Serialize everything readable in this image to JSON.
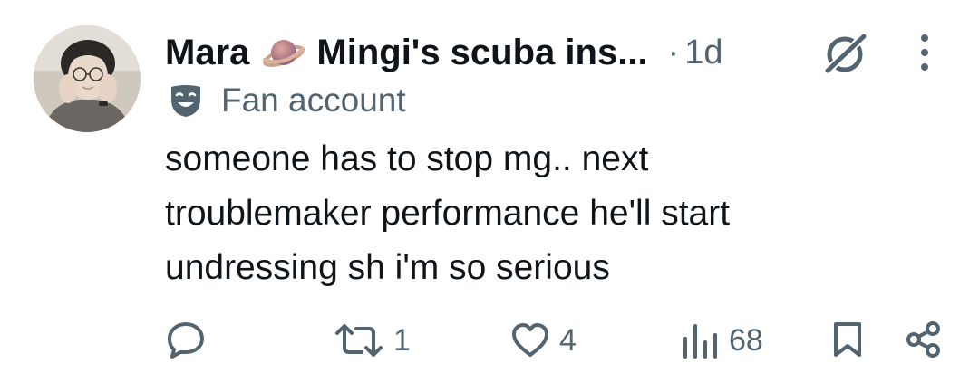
{
  "tweet": {
    "display_name": "Mara",
    "display_name_suffix": "Mingi's scuba ins...",
    "separator": "·",
    "timestamp": "1d",
    "badge_label": "Fan account",
    "text_lines": [
      "someone has to stop mg.. next",
      "troublemaker performance he'll start",
      "undressing sh i'm so serious"
    ]
  },
  "actions": {
    "reply_count": "",
    "repost_count": "1",
    "like_count": "4",
    "views_count": "68"
  },
  "icons": {
    "planet": "ringed-planet-emoji",
    "grok": "grok-icon",
    "more": "vertical-ellipsis-icon",
    "badge": "theater-mask-icon",
    "reply": "speech-bubble-icon",
    "repost": "repost-arrows-icon",
    "like": "heart-icon",
    "views": "bar-chart-icon",
    "bookmark": "bookmark-icon",
    "share": "share-icon"
  },
  "colors": {
    "text_primary": "#0f1419",
    "text_secondary": "#536471",
    "background": "#ffffff"
  }
}
